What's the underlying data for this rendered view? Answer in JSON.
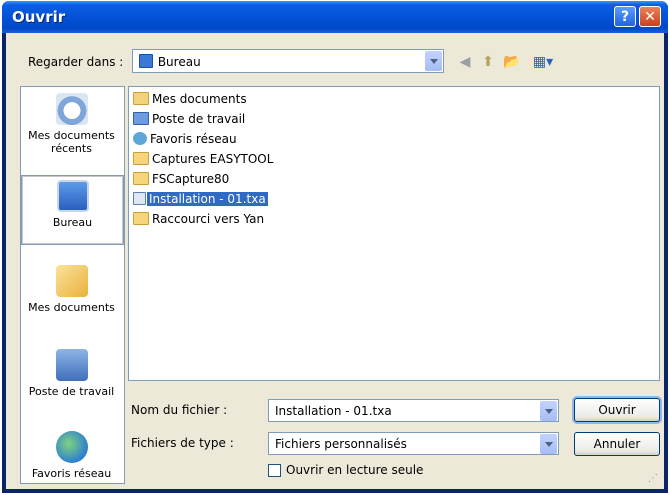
{
  "window": {
    "title": "Ouvrir",
    "help_glyph": "?",
    "close_glyph": "✕"
  },
  "look_in": {
    "label": "Regarder dans :",
    "value": "Bureau"
  },
  "toolbar": {
    "back_glyph": "◀",
    "up_glyph": "⬆",
    "new_folder_glyph": "📂",
    "views_glyph": "▦▾"
  },
  "places": [
    {
      "label": "Mes documents récents",
      "icon": "recent-documents-icon"
    },
    {
      "label": "Bureau",
      "icon": "desktop-icon"
    },
    {
      "label": "Mes documents",
      "icon": "my-documents-icon"
    },
    {
      "label": "Poste de travail",
      "icon": "my-computer-icon"
    },
    {
      "label": "Favoris réseau",
      "icon": "network-places-icon"
    }
  ],
  "files": [
    {
      "name": "Mes documents",
      "icon": "my-documents-folder-icon"
    },
    {
      "name": "Poste de travail",
      "icon": "my-computer-icon"
    },
    {
      "name": "Favoris réseau",
      "icon": "network-places-icon"
    },
    {
      "name": "Captures EASYTOOL",
      "icon": "folder-icon"
    },
    {
      "name": "FSCapture80",
      "icon": "folder-icon"
    },
    {
      "name": "Installation - 01.txa",
      "icon": "file-icon"
    },
    {
      "name": "Raccourci vers Yan",
      "icon": "shortcut-folder-icon"
    }
  ],
  "filename": {
    "label": "Nom du fichier :",
    "value": "Installation - 01.txa"
  },
  "filetype": {
    "label": "Fichiers de type :",
    "value": "Fichiers personnalisés"
  },
  "buttons": {
    "open": "Ouvrir",
    "cancel": "Annuler"
  },
  "readonly": {
    "label": "Ouvrir en lecture seule",
    "checked": false
  },
  "colors": {
    "title_bar": "#0453d8",
    "selection": "#316ac5",
    "dialog_bg": "#ece9d8"
  }
}
